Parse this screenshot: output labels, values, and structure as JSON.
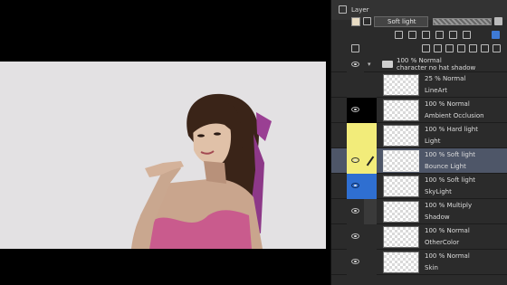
{
  "panel": {
    "tab_label": "Layer",
    "blend_mode": "Soft light",
    "colors": {
      "panel_bg": "#2b2b2b",
      "selected_row": "#4e5668",
      "canvas_paper": "#e3e1e3",
      "yellow_tag": "#f2ec7a",
      "blue_tag": "#2f6fd1",
      "black_tag": "#000000"
    }
  },
  "folder": {
    "mode": "100 % Normal",
    "name": "character no hat shadow",
    "icon": "folder-icon"
  },
  "layers": [
    {
      "mode": "25 % Normal",
      "name": "LineArt",
      "color_tag": "none",
      "eye": false
    },
    {
      "mode": "100 % Normal",
      "name": "Ambient Occlusion",
      "color_tag": "black",
      "eye": true
    },
    {
      "mode": "100 % Hard light",
      "name": "Light",
      "color_tag": "yellow",
      "eye": false
    },
    {
      "mode": "100 % Soft light",
      "name": "Bounce Light",
      "color_tag": "yellow",
      "eye": true,
      "selected": true
    },
    {
      "mode": "100 % Soft light",
      "name": "SkyLight",
      "color_tag": "blue",
      "eye": true
    },
    {
      "mode": "100 % Multiply",
      "name": "Shadow",
      "color_tag": "none",
      "eye": true
    },
    {
      "mode": "100 % Normal",
      "name": "OtherColor",
      "color_tag": "none",
      "eye": true
    },
    {
      "mode": "100 % Normal",
      "name": "Skin",
      "color_tag": "none",
      "eye": true
    }
  ]
}
